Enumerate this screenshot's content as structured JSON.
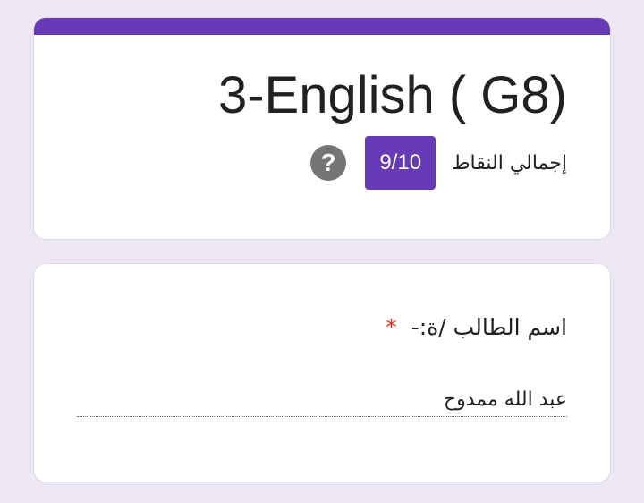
{
  "colors": {
    "accent": "#673ab7",
    "background": "#ede7f6",
    "required": "#d93025",
    "help_icon": "#757575"
  },
  "header": {
    "title": "3-English ( G8)",
    "score_label": "إجمالي النقاط",
    "score_value": "9/10",
    "help_icon": "question-mark",
    "help_symbol": "?"
  },
  "question": {
    "title": "اسم الطالب /ة:-",
    "required_marker": "*",
    "answer_value": "عبد الله ممدوح"
  }
}
